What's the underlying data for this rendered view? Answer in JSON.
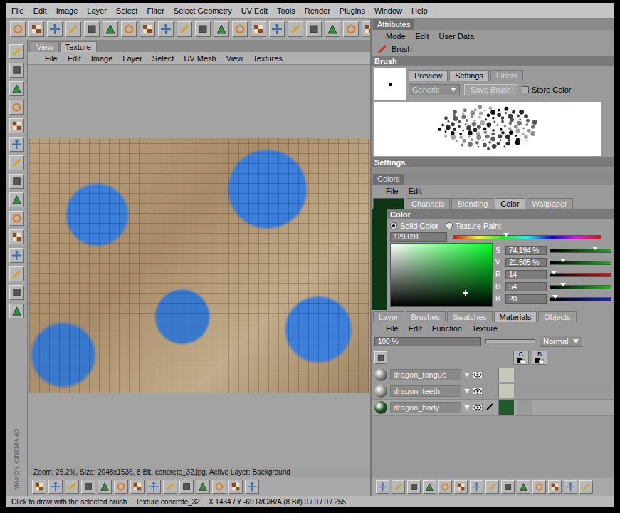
{
  "menu": [
    "File",
    "Edit",
    "Image",
    "Layer",
    "Select",
    "Filter",
    "Select Geometry",
    "UV Edit",
    "Tools",
    "Render",
    "Plugins",
    "Window",
    "Help"
  ],
  "texture_view": {
    "tabs": [
      {
        "label": "View",
        "selected": false
      },
      {
        "label": "Texture",
        "selected": true
      }
    ],
    "menu": [
      "File",
      "Edit",
      "Image",
      "Layer",
      "Select",
      "UV Mesh",
      "View",
      "Textures"
    ],
    "info": "Zoom: 25.2%, Size: 2048x1536, 8 Bit, concrete_32.jpg, Active Layer: Background"
  },
  "attributes": {
    "tab": "Attributes",
    "menu": [
      "Mode",
      "Edit",
      "User Data"
    ],
    "object": "Brush",
    "section": "Brush",
    "tabs": [
      {
        "label": "Preview",
        "selected": true,
        "disabled": false
      },
      {
        "label": "Settings",
        "selected": false,
        "disabled": false
      },
      {
        "label": "Filters",
        "selected": false,
        "disabled": true
      }
    ],
    "preset": {
      "value": "Generic",
      "disabled": true
    },
    "save_button": {
      "label": "Save Brush",
      "disabled": true
    },
    "store_color": {
      "label": "Store Color",
      "checked": false
    },
    "settings_header": "Settings"
  },
  "colors": {
    "tab": "Colors",
    "menu": [
      "File",
      "Edit"
    ],
    "current_color": "#0e3614",
    "tabs": [
      {
        "label": "Channels",
        "selected": false
      },
      {
        "label": "Blending",
        "selected": false
      },
      {
        "label": "Color",
        "selected": true
      },
      {
        "label": "Wallpaper",
        "selected": false
      }
    ],
    "section": "Color",
    "modes": [
      {
        "label": "Solid Color",
        "selected": true
      },
      {
        "label": "Texture Paint",
        "selected": false
      }
    ],
    "hue": {
      "value": "129.091",
      "level": 0.359
    },
    "picker": {
      "saturation": 0.742,
      "value": 0.215
    },
    "sliders": [
      {
        "label": "S",
        "value": "74.194 %",
        "level": 0.742,
        "color": "#1fa52a"
      },
      {
        "label": "V",
        "value": "21.505 %",
        "level": 0.215,
        "color": "#22b02a"
      },
      {
        "label": "R",
        "value": "14",
        "level": 0.055,
        "color": "#d01818"
      },
      {
        "label": "G",
        "value": "54",
        "level": 0.212,
        "color": "#18c018"
      },
      {
        "label": "B",
        "value": "20",
        "level": 0.078,
        "color": "#1828d0"
      }
    ]
  },
  "materials_panel": {
    "tabs": [
      {
        "label": "Layer",
        "selected": false
      },
      {
        "label": "Brushes",
        "selected": false
      },
      {
        "label": "Swatches",
        "selected": false
      },
      {
        "label": "Materials",
        "selected": true
      },
      {
        "label": "Objects",
        "selected": false
      }
    ],
    "menu": [
      "File",
      "Edit",
      "Function",
      "Texture"
    ],
    "opacity": "100 %",
    "blend_mode": "Normal",
    "channels": [
      "C",
      "B"
    ],
    "materials": [
      {
        "name": "dragon_tongue",
        "color": "#8c8c84",
        "selected": false
      },
      {
        "name": "dragon_teeth",
        "color": "#96968e",
        "selected": false
      },
      {
        "name": "dragon_body",
        "color": "#1f5a2a",
        "selected": true
      }
    ]
  },
  "status": {
    "hint": "Click to draw with the selected brush",
    "texture": "Texture concrete_32",
    "coords": "X 1434 / Y -69 R/G/B/A (8 Bit) 0 / 0 / 0 / 255"
  },
  "logo": {
    "brand": "MAXON",
    "product": "CINEMA 4D"
  }
}
